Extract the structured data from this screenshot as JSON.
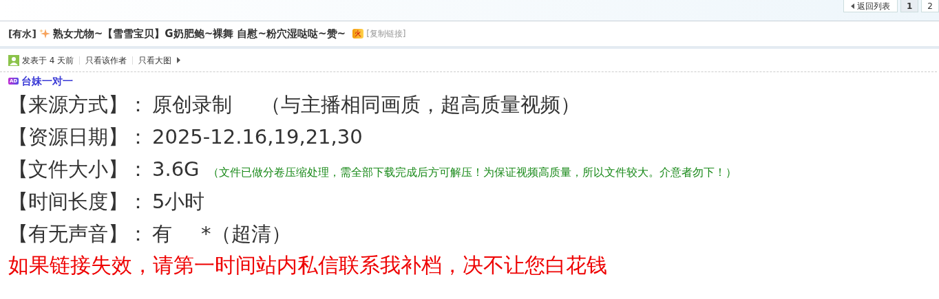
{
  "pager": {
    "back": "返回列表",
    "pages": [
      {
        "label": "1",
        "selected": true
      },
      {
        "label": "2",
        "selected": false
      }
    ]
  },
  "thread": {
    "tag": "[有水]",
    "title": "熟女尤物~【雪雪宝贝】G奶肥鲍~裸舞 自慰~粉穴湿哒哒~赞~",
    "hot_badge": "火",
    "copy_link": "[复制链接]"
  },
  "meta": {
    "posted": "发表于 4 天前",
    "links": [
      "只看该作者",
      "只看大图"
    ]
  },
  "ad": {
    "badge": "AD",
    "text": "台妹一对一"
  },
  "lines": [
    {
      "kind": "plain",
      "label": "【来源方式】：",
      "value": "原创录制",
      "note": "（与主播相同画质，超高质量视频）"
    },
    {
      "label": "【资源日期】：",
      "value": "2025-12.16,19,21,30"
    },
    {
      "kind": "remark",
      "label": "【文件大小】：",
      "value": "3.6G",
      "note": "（文件已做分卷压缩处理，需全部下载完成后方可解压！为保证视频高质量，所以文件较大。介意者勿下！）"
    },
    {
      "label": "【时间长度】：",
      "value": "5小时"
    },
    {
      "kind": "plain",
      "label": "【有无声音】：",
      "value": "有",
      "note": "*（超清）"
    }
  ],
  "notice": "如果链接失效，请第一时间站内私信联系我补档，决不让您白花钱"
}
